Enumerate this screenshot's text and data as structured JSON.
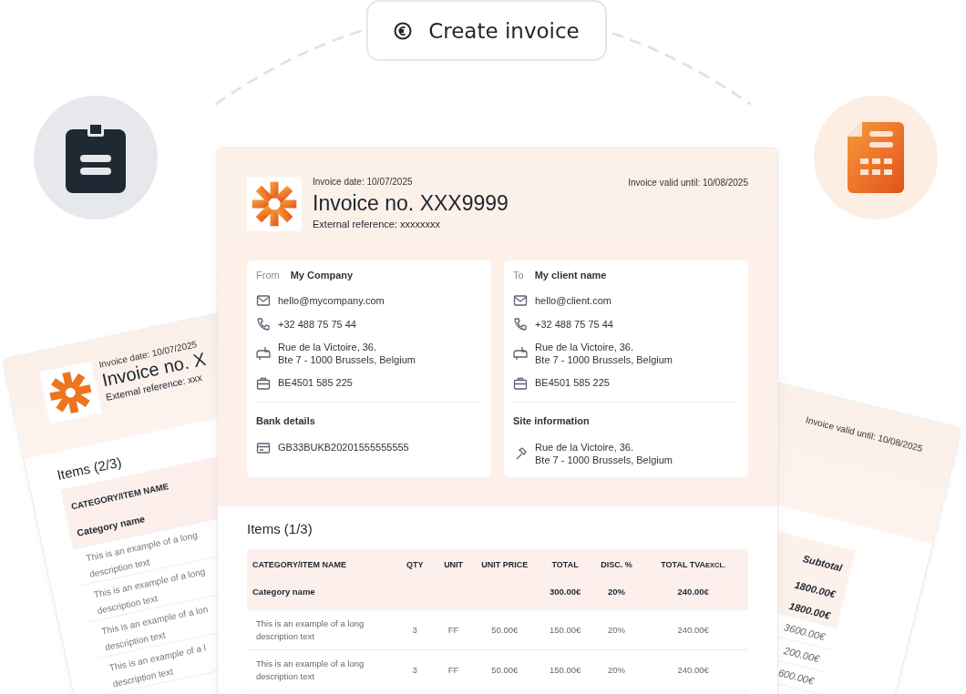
{
  "action_button": {
    "label": "Create invoice"
  },
  "back_left": {
    "date": "Invoice date: 10/07/2025",
    "title": "Invoice no. X",
    "reference": "External reference: xxx",
    "items_title": "Items (2/3)",
    "column": "CATEGORY/ITEM NAME",
    "category": "Category name",
    "rows": [
      {
        "lines": [
          "This is an example of a long",
          "description text"
        ]
      },
      {
        "lines": [
          "This is an example of a long",
          "description text"
        ]
      },
      {
        "lines": [
          "This is an example of a lon",
          "description text"
        ]
      },
      {
        "lines": [
          "This is an example of a l",
          "description text"
        ]
      }
    ]
  },
  "back_right": {
    "valid_until": "Invoice valid until: 10/08/2025",
    "column": "Subtotal",
    "rows": [
      {
        "kind": "category",
        "text": "1800.00€"
      },
      {
        "kind": "category",
        "text": "1800.00€"
      },
      {
        "kind": "item",
        "text": "3600.00€"
      },
      {
        "kind": "item",
        "text": "200.00€"
      },
      {
        "kind": "item",
        "text": "600.00€"
      }
    ]
  },
  "invoice": {
    "date": "Invoice date: 10/07/2025",
    "valid_until": "Invoice valid until: 10/08/2025",
    "title": "Invoice no. XXX9999",
    "reference": "External reference: xxxxxxxx",
    "parties": [
      {
        "role": "From",
        "name": "My Company",
        "contacts": [
          {
            "kind": "email",
            "lines": [
              "hello@mycompany.com"
            ]
          },
          {
            "kind": "phone",
            "lines": [
              "+32 488 75 75 44"
            ]
          },
          {
            "kind": "address",
            "lines": [
              "Rue de la Victoire, 36.",
              "Bte 7 - 1000 Brussels, Belgium"
            ]
          },
          {
            "kind": "vat",
            "lines": [
              "BE4501 585 225"
            ]
          }
        ],
        "extra_title": "Bank details",
        "extra": [
          {
            "kind": "bank",
            "lines": [
              "GB33BUKB20201555555555"
            ]
          }
        ]
      },
      {
        "role": "To",
        "name": "My client name",
        "contacts": [
          {
            "kind": "email",
            "lines": [
              "hello@client.com"
            ]
          },
          {
            "kind": "phone",
            "lines": [
              "+32 488 75 75 44"
            ]
          },
          {
            "kind": "address",
            "lines": [
              "Rue de la Victoire, 36.",
              "Bte 7 - 1000 Brussels, Belgium"
            ]
          },
          {
            "kind": "vat",
            "lines": [
              "BE4501 585 225"
            ]
          }
        ],
        "extra_title": "Site information",
        "extra": [
          {
            "kind": "site",
            "lines": [
              "Rue de la Victoire, 36.",
              "Bte 7 - 1000 Brussels, Belgium"
            ]
          }
        ]
      }
    ],
    "items_title": "Items (1/3)",
    "table": {
      "columns": [
        {
          "label": "CATEGORY/ITEM NAME"
        },
        {
          "label": "QTY"
        },
        {
          "label": "UNIT"
        },
        {
          "label": "UNIT PRICE"
        },
        {
          "label": "TOTAL"
        },
        {
          "label": "DISC. %"
        },
        {
          "label": "TOTAL TVA",
          "note": "EXCL."
        }
      ],
      "rows": [
        {
          "kind": "category",
          "cells": [
            "Category name",
            "",
            "",
            "",
            "300.00€",
            "20%",
            "240.00€"
          ]
        },
        {
          "kind": "item",
          "cells": [
            "This is an example of a long description text",
            "3",
            "FF",
            "50.00€",
            "150.00€",
            "20%",
            "240.00€"
          ]
        },
        {
          "kind": "item",
          "cells": [
            "This is an example of a long description text",
            "3",
            "FF",
            "50.00€",
            "150.00€",
            "20%",
            "240.00€"
          ]
        }
      ]
    }
  }
}
